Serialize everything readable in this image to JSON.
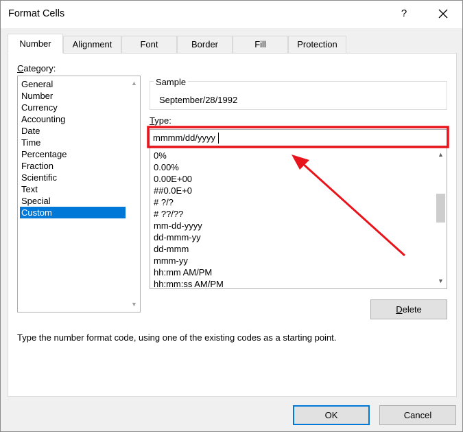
{
  "window": {
    "title": "Format Cells"
  },
  "tabs": [
    {
      "label": "Number"
    },
    {
      "label": "Alignment"
    },
    {
      "label": "Font"
    },
    {
      "label": "Border"
    },
    {
      "label": "Fill"
    },
    {
      "label": "Protection"
    }
  ],
  "category": {
    "label_accel": "C",
    "label_rest": "ategory:",
    "items": [
      "General",
      "Number",
      "Currency",
      "Accounting",
      "Date",
      "Time",
      "Percentage",
      "Fraction",
      "Scientific",
      "Text",
      "Special",
      "Custom"
    ],
    "selected": "Custom"
  },
  "sample": {
    "label": "Sample",
    "value": "September/28/1992"
  },
  "type": {
    "label_accel": "T",
    "label_rest": "ype:",
    "value": "mmmm/dd/yyyy",
    "formats": [
      "0%",
      "0.00%",
      "0.00E+00",
      "##0.0E+0",
      "# ?/?",
      "# ??/??",
      "mm-dd-yyyy",
      "dd-mmm-yy",
      "dd-mmm",
      "mmm-yy",
      "hh:mm AM/PM",
      "hh:mm:ss AM/PM"
    ]
  },
  "buttons": {
    "delete_accel": "D",
    "delete_rest": "elete",
    "ok": "OK",
    "cancel": "Cancel"
  },
  "hint": "Type the number format code, using one of the existing codes as a starting point.",
  "colors": {
    "annotation": "#e8141b",
    "selection": "#0078d7"
  }
}
